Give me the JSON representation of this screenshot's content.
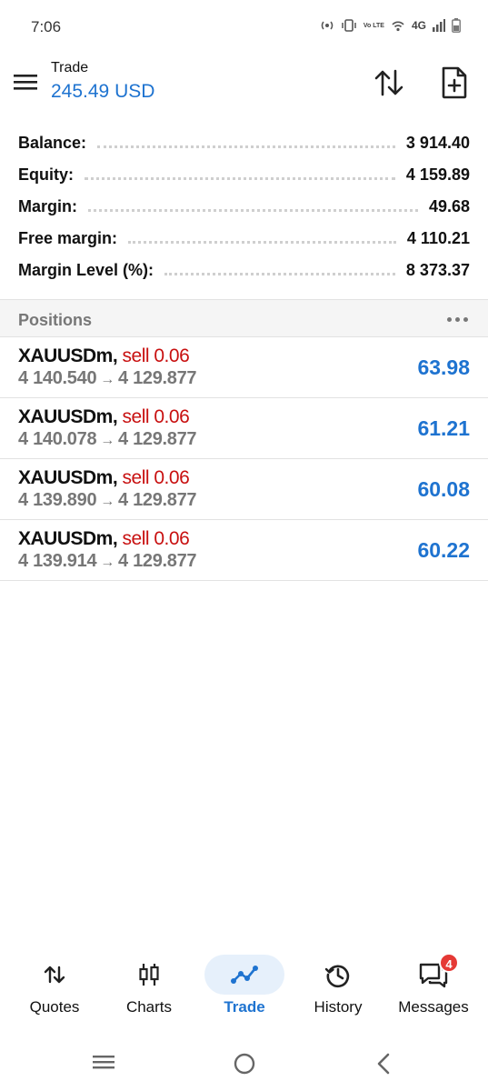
{
  "status_bar": {
    "time": "7:06",
    "network": "4G",
    "volte": "Vo LTE"
  },
  "header": {
    "title": "Trade",
    "balance_display": "245.49 USD",
    "accent_color": "#1e73d0"
  },
  "summary": [
    {
      "label": "Balance:",
      "value": "3 914.40"
    },
    {
      "label": "Equity:",
      "value": "4 159.89"
    },
    {
      "label": "Margin:",
      "value": "49.68"
    },
    {
      "label": "Free margin:",
      "value": "4 110.21"
    },
    {
      "label": "Margin Level (%):",
      "value": "8 373.37"
    }
  ],
  "positions": {
    "title": "Positions",
    "items": [
      {
        "symbol": "XAUUSDm,",
        "side": "sell 0.06",
        "open_price": "4 140.540",
        "arrow": "→",
        "current_price": "4 129.877",
        "profit": "63.98"
      },
      {
        "symbol": "XAUUSDm,",
        "side": "sell 0.06",
        "open_price": "4 140.078",
        "arrow": "→",
        "current_price": "4 129.877",
        "profit": "61.21"
      },
      {
        "symbol": "XAUUSDm,",
        "side": "sell 0.06",
        "open_price": "4 139.890",
        "arrow": "→",
        "current_price": "4 129.877",
        "profit": "60.08"
      },
      {
        "symbol": "XAUUSDm,",
        "side": "sell 0.06",
        "open_price": "4 139.914",
        "arrow": "→",
        "current_price": "4 129.877",
        "profit": "60.22"
      }
    ],
    "sell_color": "#c81010",
    "profit_color": "#1e73d0"
  },
  "bottom_nav": {
    "items": [
      {
        "label": "Quotes",
        "icon": "arrows-updown-icon"
      },
      {
        "label": "Charts",
        "icon": "candlestick-icon"
      },
      {
        "label": "Trade",
        "icon": "trend-line-icon",
        "active": true
      },
      {
        "label": "History",
        "icon": "history-icon"
      },
      {
        "label": "Messages",
        "icon": "messages-icon",
        "badge": "4"
      }
    ]
  }
}
